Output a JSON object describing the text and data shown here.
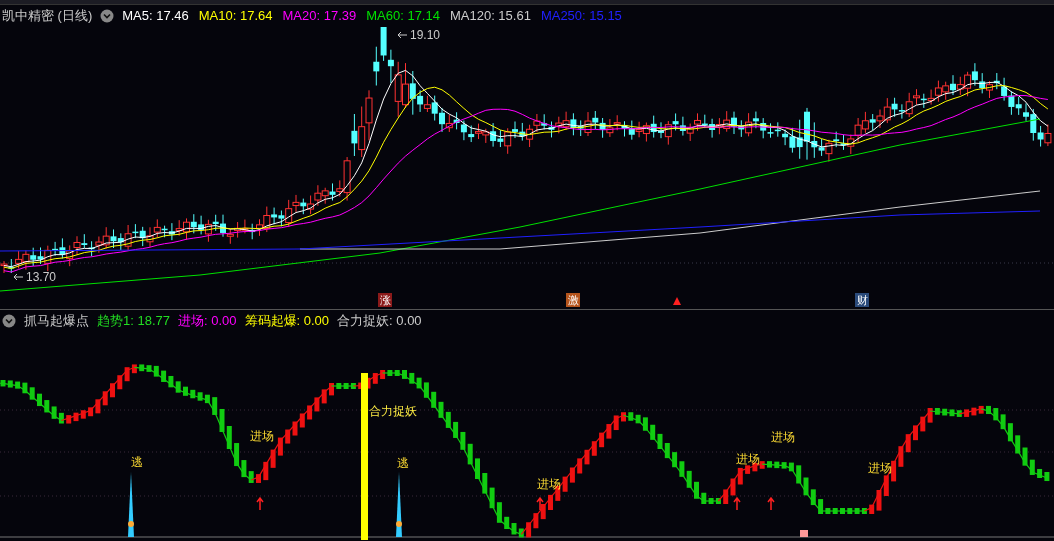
{
  "main_panel": {
    "title": "凯中精密 (日线)",
    "ma_legend": [
      {
        "label": "MA5: 17.46",
        "color": "#ffffff"
      },
      {
        "label": "MA10: 17.64",
        "color": "#ffff00"
      },
      {
        "label": "MA20: 17.39",
        "color": "#ff00ff"
      },
      {
        "label": "MA60: 17.14",
        "color": "#00e000"
      },
      {
        "label": "MA120: 15.61",
        "color": "#cccccc"
      },
      {
        "label": "MA250: 15.15",
        "color": "#2020ff"
      }
    ],
    "high_label": "19.10",
    "low_label": "13.70",
    "event_markers": [
      {
        "kind": "badge",
        "text": "涨",
        "color": "#8b1a1a"
      },
      {
        "kind": "badge",
        "text": "激",
        "color": "#b5541c"
      },
      {
        "kind": "flag",
        "color": "#ff2020"
      },
      {
        "kind": "badge",
        "text": "财",
        "color": "#2a4a7a"
      }
    ]
  },
  "indicator_panel": {
    "title": "抓马起爆点",
    "legend": [
      {
        "label": "趋势1: 18.77",
        "color": "#22dd22"
      },
      {
        "label": "进场: 0.00",
        "color": "#ff00ff"
      },
      {
        "label": "筹码起爆: 0.00",
        "color": "#ffff00"
      },
      {
        "label": "合力捉妖: 0.00",
        "color": "#cccccc"
      }
    ],
    "signals": [
      {
        "kind": "escape",
        "text": "逃"
      },
      {
        "kind": "entry",
        "text": "进场"
      },
      {
        "kind": "demon",
        "text": "合力捉妖"
      },
      {
        "kind": "escape",
        "text": "逃"
      },
      {
        "kind": "entry",
        "text": "进场"
      },
      {
        "kind": "entry",
        "text": "进场"
      },
      {
        "kind": "entry",
        "text": "进场"
      },
      {
        "kind": "entry",
        "text": "进场"
      }
    ]
  }
}
